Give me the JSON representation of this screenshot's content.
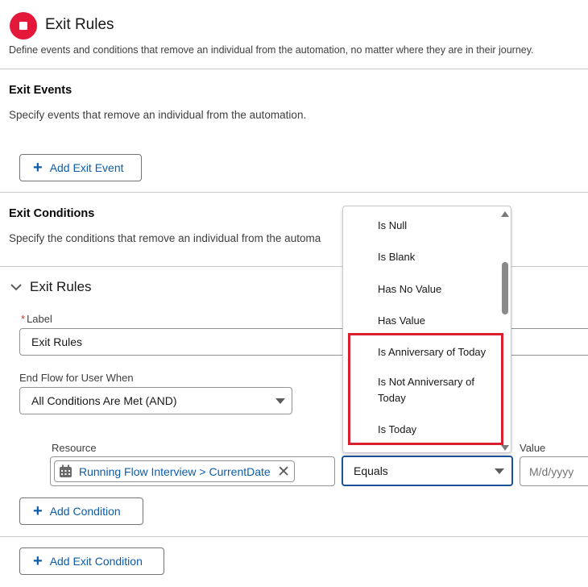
{
  "header": {
    "title": "Exit Rules",
    "subtitle": "Define events and conditions that remove an individual from the automation, no matter where they are in their journey."
  },
  "exit_events": {
    "title": "Exit Events",
    "description": "Specify events that remove an individual from the automation.",
    "add_button": "Add Exit Event"
  },
  "exit_conditions": {
    "title": "Exit Conditions",
    "description": "Specify the conditions that remove an individual from the automa"
  },
  "rules": {
    "section_title": "Exit Rules",
    "label_required": "*",
    "label_label": "Label",
    "label_value": "Exit Rules",
    "end_flow_label": "End Flow for User When",
    "end_flow_value": "All Conditions Are Met (AND)",
    "resource_label": "Resource",
    "resource_value": "Running Flow Interview > CurrentDate",
    "operator_value": "Equals",
    "value_label": "Value",
    "value_placeholder": "M/d/yyyy",
    "add_condition": "Add Condition"
  },
  "add_exit_condition": "Add Exit Condition",
  "operator_options": [
    "Is Null",
    "Is Blank",
    "Has No Value",
    "Has Value",
    "Is Anniversary of Today",
    "Is Not Anniversary of",
    "Today",
    "Is Today"
  ],
  "colors": {
    "brand_blue": "#0b5cab",
    "stop_red": "#e3183a",
    "highlight_red": "#d8202e",
    "focus_border": "#1b5297"
  }
}
